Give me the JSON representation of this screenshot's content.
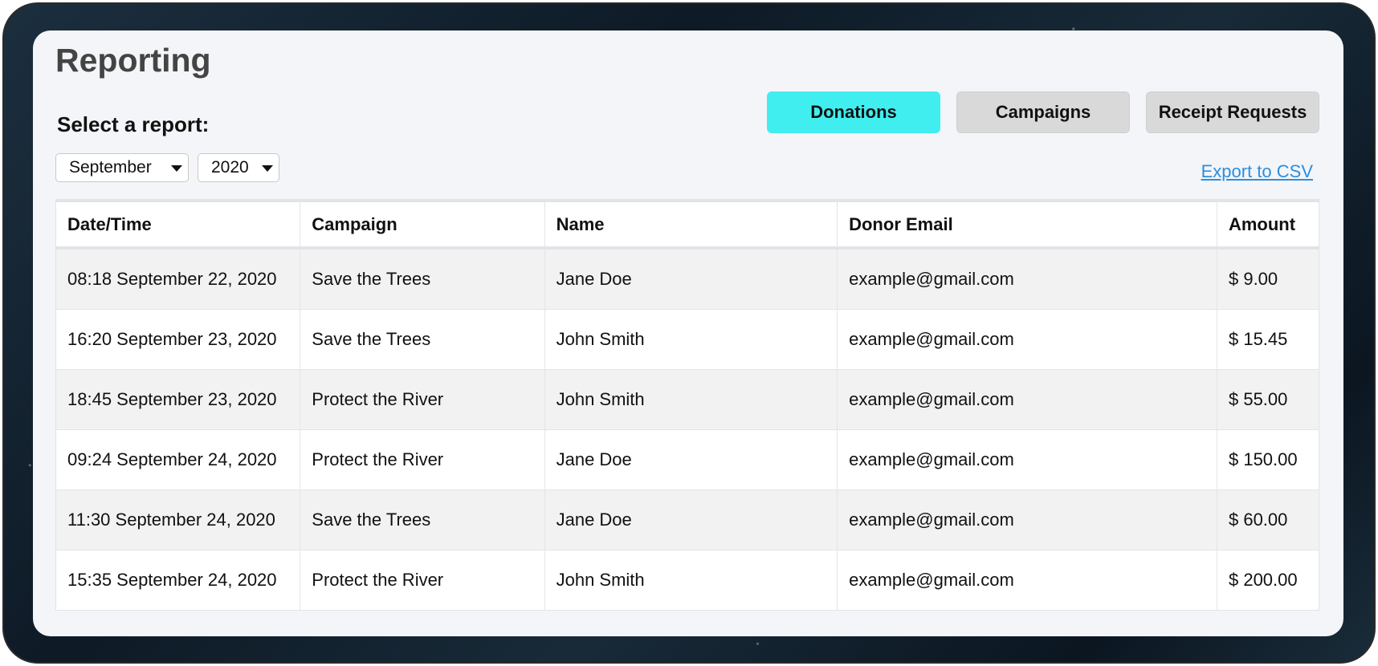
{
  "page": {
    "title": "Reporting",
    "select_label": "Select a report:"
  },
  "filters": {
    "month": "September",
    "year": "2020"
  },
  "tabs": [
    {
      "label": "Donations",
      "active": true
    },
    {
      "label": "Campaigns",
      "active": false
    },
    {
      "label": "Receipt Requests",
      "active": false
    }
  ],
  "export_label": "Export to CSV",
  "table": {
    "columns": [
      "Date/Time",
      "Campaign",
      "Name",
      "Donor Email",
      "Amount"
    ],
    "rows": [
      [
        "08:18 September 22, 2020",
        "Save the Trees",
        "Jane Doe",
        "example@gmail.com",
        "$ 9.00"
      ],
      [
        "16:20 September 23, 2020",
        "Save the Trees",
        "John Smith",
        "example@gmail.com",
        "$ 15.45"
      ],
      [
        "18:45 September 23, 2020",
        "Protect the River",
        "John Smith",
        "example@gmail.com",
        "$ 55.00"
      ],
      [
        "09:24 September 24, 2020",
        "Protect the River",
        "Jane Doe",
        "example@gmail.com",
        "$ 150.00"
      ],
      [
        "11:30 September 24, 2020",
        "Save the Trees",
        "Jane Doe",
        "example@gmail.com",
        "$ 60.00"
      ],
      [
        "15:35 September 24, 2020",
        "Protect the River",
        "John Smith",
        "example@gmail.com",
        "$ 200.00"
      ]
    ]
  },
  "colors": {
    "active_tab": "#40eef0",
    "inactive_tab": "#d9d9d9",
    "link": "#2a8fe0",
    "title": "#444444"
  },
  "icons": {
    "dropdown": "caret-down-icon"
  }
}
